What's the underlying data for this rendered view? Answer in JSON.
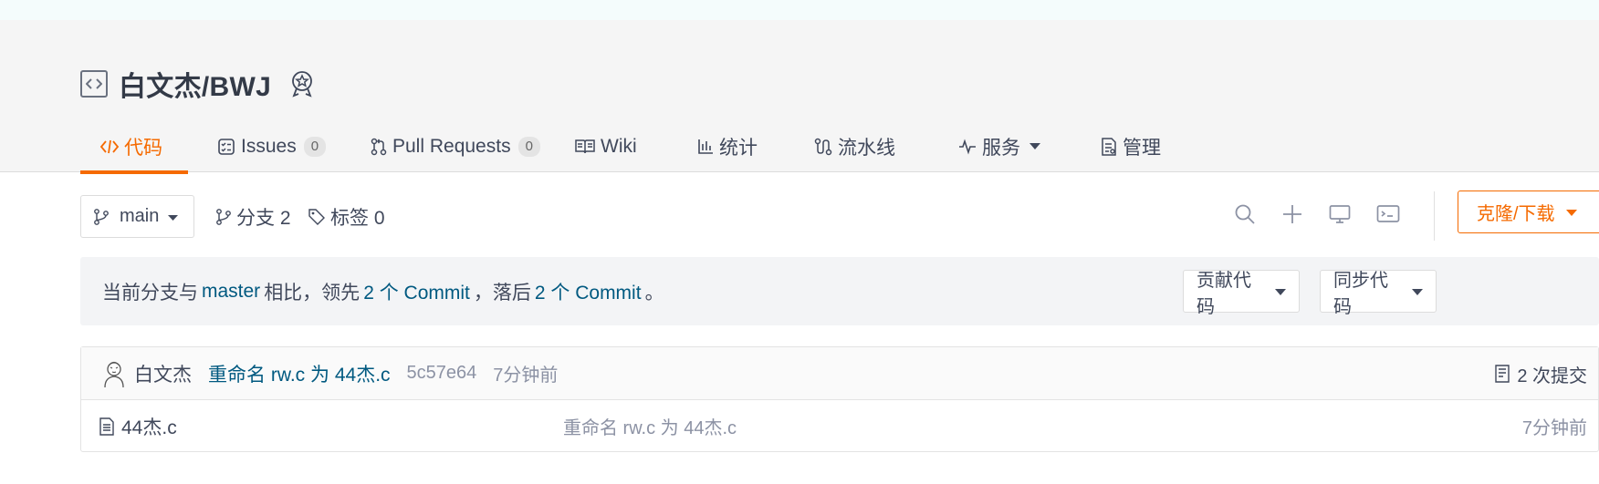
{
  "repo": {
    "owner": "白文杰",
    "name": "BWJ",
    "full_name": "白文杰/BWJ"
  },
  "tabs": [
    {
      "label": "代码",
      "icon": "code-icon",
      "active": true
    },
    {
      "label": "Issues",
      "icon": "issues-icon",
      "count": "0"
    },
    {
      "label": "Pull Requests",
      "icon": "pull-request-icon",
      "count": "0"
    },
    {
      "label": "Wiki",
      "icon": "book-icon"
    },
    {
      "label": "统计",
      "icon": "stats-icon"
    },
    {
      "label": "流水线",
      "icon": "pipeline-icon"
    },
    {
      "label": "服务",
      "icon": "pulse-icon",
      "dropdown": true
    },
    {
      "label": "管理",
      "icon": "manage-icon"
    }
  ],
  "toolbar": {
    "branch": "main",
    "branches_label": "分支 2",
    "tags_label": "标签 0",
    "clone_label": "克隆/下载"
  },
  "notice": {
    "prefix": "当前分支与",
    "branch": "master",
    "mid1": "相比，领先",
    "ahead": "2 个 Commit",
    "mid2": "，落后",
    "behind": "2 个 Commit",
    "suffix": "。",
    "contribute_label": "贡献代码",
    "sync_label": "同步代码"
  },
  "latest_commit": {
    "author": "白文杰",
    "message": "重命名 rw.c 为 44杰.c",
    "sha": "5c57e64",
    "time": "7分钟前",
    "commit_count": "2 次提交"
  },
  "files": [
    {
      "name": "44杰.c",
      "message": "重命名 rw.c 为 44杰.c",
      "time": "7分钟前"
    }
  ],
  "colors": {
    "accent": "#f56a00",
    "link": "#005980",
    "muted": "#8c92a4"
  }
}
